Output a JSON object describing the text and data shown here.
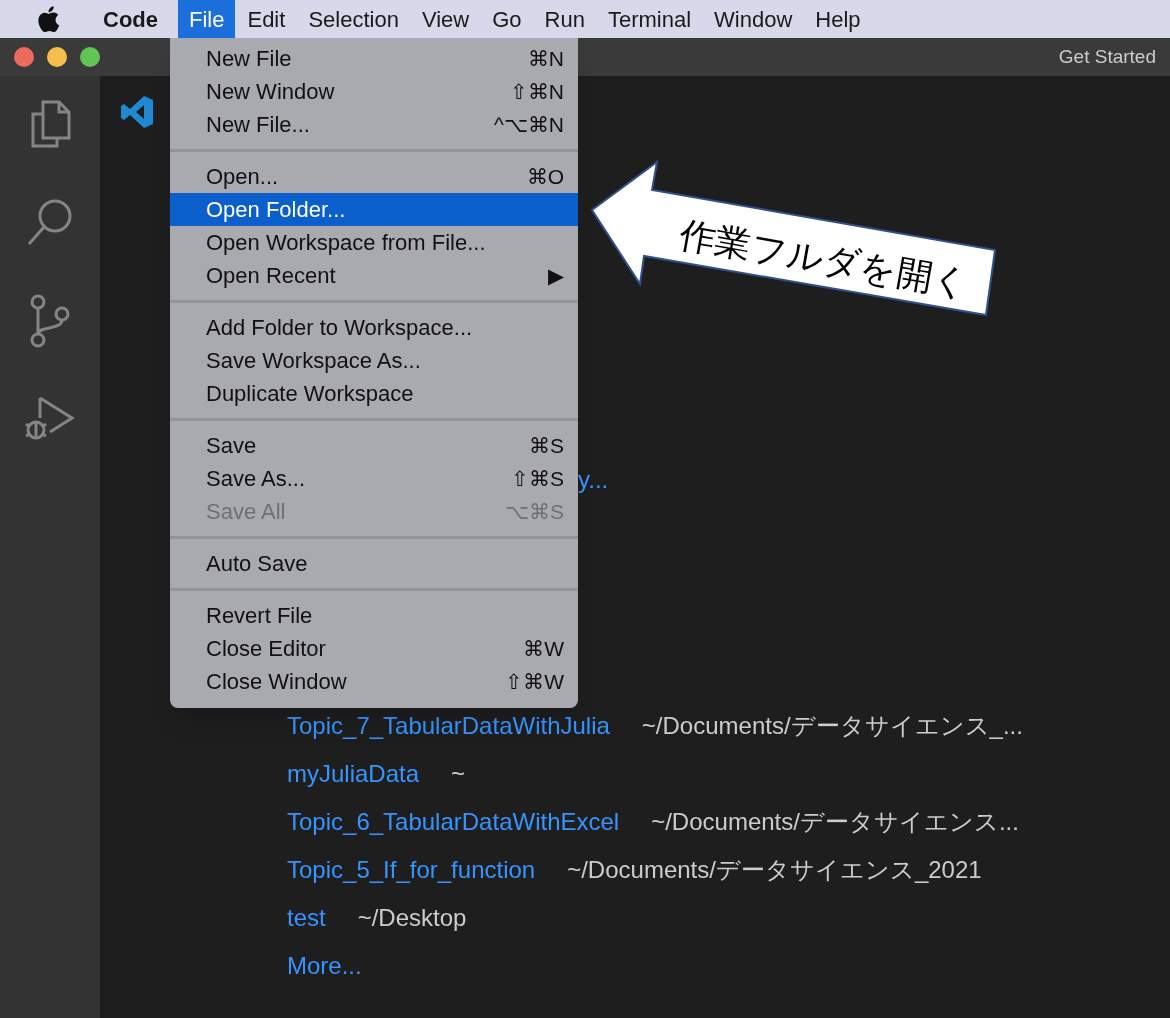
{
  "menubar": {
    "items": [
      {
        "label": "Code",
        "selected": false,
        "bold": true
      },
      {
        "label": "File",
        "selected": true,
        "bold": false
      },
      {
        "label": "Edit",
        "selected": false,
        "bold": false
      },
      {
        "label": "Selection",
        "selected": false,
        "bold": false
      },
      {
        "label": "View",
        "selected": false,
        "bold": false
      },
      {
        "label": "Go",
        "selected": false,
        "bold": false
      },
      {
        "label": "Run",
        "selected": false,
        "bold": false
      },
      {
        "label": "Terminal",
        "selected": false,
        "bold": false
      },
      {
        "label": "Window",
        "selected": false,
        "bold": false
      },
      {
        "label": "Help",
        "selected": false,
        "bold": false
      }
    ]
  },
  "window": {
    "title": "Get Started"
  },
  "file_menu": {
    "groups": [
      [
        {
          "label": "New File",
          "shortcut": "⌘N",
          "selected": false,
          "disabled": false
        },
        {
          "label": "New Window",
          "shortcut": "⇧⌘N",
          "selected": false,
          "disabled": false
        },
        {
          "label": "New File...",
          "shortcut": "^⌥⌘N",
          "selected": false,
          "disabled": false
        }
      ],
      [
        {
          "label": "Open...",
          "shortcut": "⌘O",
          "selected": false,
          "disabled": false
        },
        {
          "label": "Open Folder...",
          "selected": true,
          "disabled": false
        },
        {
          "label": "Open Workspace from File...",
          "selected": false,
          "disabled": false
        },
        {
          "label": "Open Recent",
          "shortcut": "▶",
          "selected": false,
          "disabled": false
        }
      ],
      [
        {
          "label": "Add Folder to Workspace...",
          "selected": false,
          "disabled": false
        },
        {
          "label": "Save Workspace As...",
          "selected": false,
          "disabled": false
        },
        {
          "label": "Duplicate Workspace",
          "selected": false,
          "disabled": false
        }
      ],
      [
        {
          "label": "Save",
          "shortcut": "⌘S",
          "selected": false,
          "disabled": false
        },
        {
          "label": "Save As...",
          "shortcut": "⇧⌘S",
          "selected": false,
          "disabled": false
        },
        {
          "label": "Save All",
          "shortcut": "⌥⌘S",
          "selected": false,
          "disabled": true
        }
      ],
      [
        {
          "label": "Auto Save",
          "selected": false,
          "disabled": false
        }
      ],
      [
        {
          "label": "Revert File",
          "selected": false,
          "disabled": false
        },
        {
          "label": "Close Editor",
          "shortcut": "⌘W",
          "selected": false,
          "disabled": false
        },
        {
          "label": "Close Window",
          "shortcut": "⇧⌘W",
          "selected": false,
          "disabled": false
        }
      ]
    ]
  },
  "callout": {
    "text": "作業フルダを開く"
  },
  "get_started": {
    "start_fragment": "y...",
    "recent": [
      {
        "name": "Topic_7_TabularDataWithJulia",
        "path": "~/Documents/データサイエンス_..."
      },
      {
        "name": "myJuliaData",
        "path": "~"
      },
      {
        "name": "Topic_6_TabularDataWithExcel",
        "path": "~/Documents/データサイエンス..."
      },
      {
        "name": "Topic_5_If_for_function",
        "path": "~/Documents/データサイエンス_2021"
      },
      {
        "name": "test",
        "path": "~/Desktop"
      }
    ],
    "more": "More..."
  }
}
